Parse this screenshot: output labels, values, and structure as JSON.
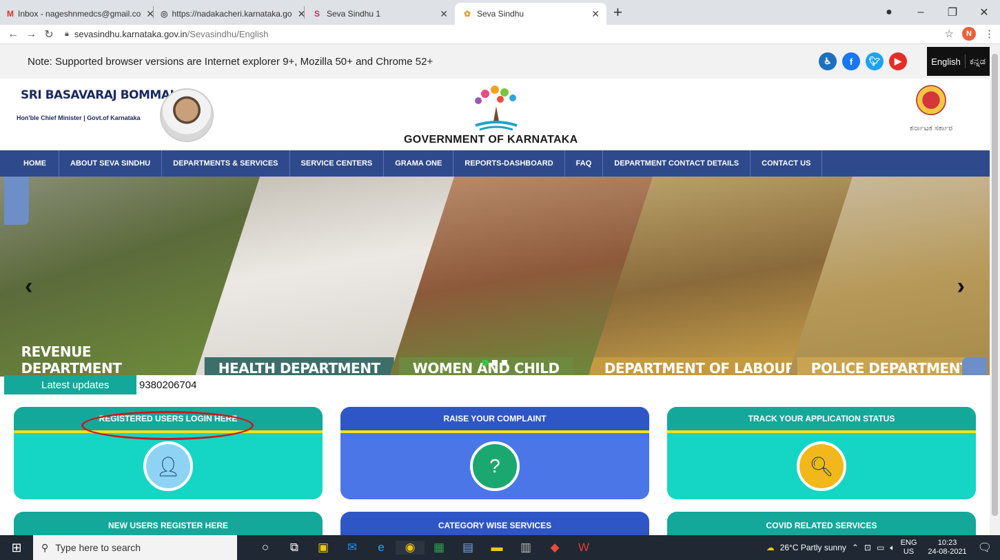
{
  "browser": {
    "tabs": [
      {
        "title": "Inbox - nageshnmedcs@gmail.co",
        "icon": "gmail-icon",
        "icon_glyph": "M",
        "icon_color": "#d93025",
        "active": false
      },
      {
        "title": "https://nadakacheri.karnataka.go",
        "icon": "globe-icon",
        "icon_glyph": "◎",
        "icon_color": "#555555",
        "active": false
      },
      {
        "title": "Seva Sindhu 1",
        "icon": "seva-sindhu-s-icon",
        "icon_glyph": "S",
        "icon_color": "#e0245e",
        "active": false
      },
      {
        "title": "Seva Sindhu",
        "icon": "seva-sindhu-tree-icon",
        "icon_glyph": "✿",
        "icon_color": "#d8a020",
        "active": true
      }
    ],
    "url_host": "sevasindhu.karnataka.gov.in",
    "url_path": "/Sevasindhu/English",
    "profile_initial": "N"
  },
  "topbar": {
    "note": "Note: Supported browser versions are Internet explorer 9+, Mozilla 50+ and Chrome 52+",
    "lang_english": "English",
    "lang_kannada": "ಕನ್ನಡ"
  },
  "header": {
    "cm_name": "SRI BASAVARAJ BOMMAI",
    "cm_role": "Hon'ble Chief Minister | Govt.of Karnataka",
    "gov_title": "GOVERNMENT OF KARNATAKA",
    "emblem_text": "ಕರ್ನಾಟಕ ಸರ್ಕಾರ"
  },
  "menu": [
    "HOME",
    "ABOUT SEVA SINDHU",
    "DEPARTMENTS & SERVICES",
    "SERVICE CENTERS",
    "GRAMA ONE",
    "REPORTS-DASHBOARD",
    "FAQ",
    "DEPARTMENT CONTACT DETAILS",
    "CONTACT US"
  ],
  "banner": {
    "panels": [
      "REVENUE DEPARTMENT",
      "HEALTH DEPARTMENT",
      "WOMEN AND CHILD",
      "DEPARTMENT OF LABOUR",
      "POLICE DEPARTMENT"
    ]
  },
  "latest": {
    "label": "Latest updates",
    "text": "9380206704"
  },
  "cards": [
    {
      "label": "REGISTERED USERS LOGIN HERE"
    },
    {
      "label": "RAISE YOUR COMPLAINT"
    },
    {
      "label": "TRACK YOUR APPLICATION STATUS"
    }
  ],
  "cards_row2": [
    "NEW USERS REGISTER HERE",
    "CATEGORY WISE SERVICES",
    "COVID RELATED SERVICES"
  ],
  "taskbar": {
    "search_placeholder": "Type here to search",
    "weather": "26°C  Partly sunny",
    "lang": "ENG",
    "region": "US",
    "time": "10:23",
    "date": "24-08-2021"
  }
}
